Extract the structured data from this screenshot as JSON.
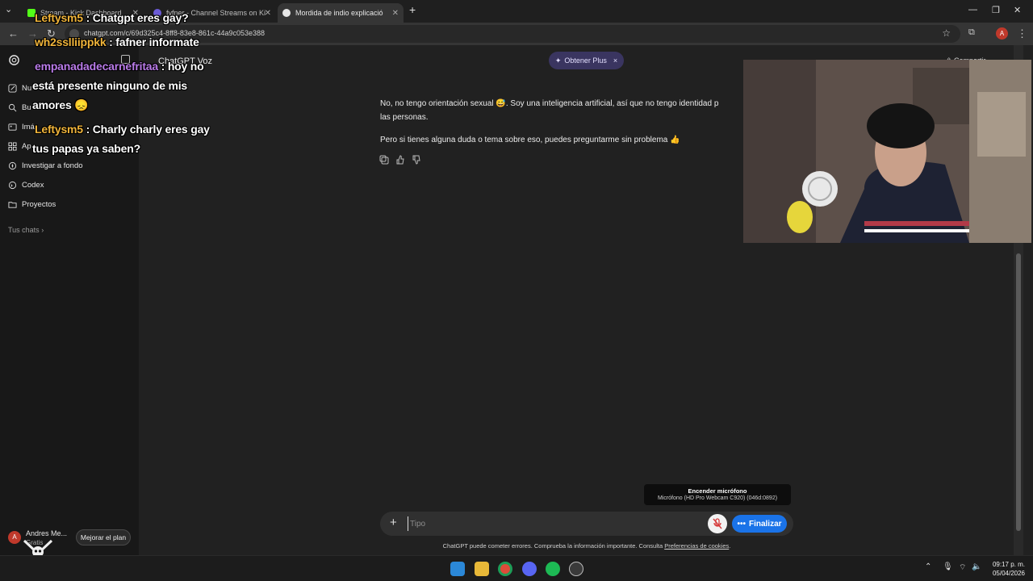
{
  "browser": {
    "tabs": [
      {
        "label": "Stream - Kick Dashboard",
        "favicon_color": "#53fc18"
      },
      {
        "label": "fvfner - Channel Streams on Ki",
        "favicon_color": "#6b5bd6"
      },
      {
        "label": "Mordida de indio explicació",
        "favicon_color": "#e6e6e6"
      }
    ],
    "url": "chatgpt.com/c/69d325c4-8ff8-83e8-861c-44a9c053e388",
    "profile_initial": "A"
  },
  "sidebar": {
    "items": [
      {
        "label": "Nu",
        "icon": "edit-icon"
      },
      {
        "label": "Bu",
        "icon": "search-icon"
      },
      {
        "label": "Imá",
        "icon": "image-icon"
      },
      {
        "label": "Ap",
        "icon": "apps-icon"
      },
      {
        "label": "Investigar a fondo",
        "icon": "research-icon"
      },
      {
        "label": "Codex",
        "icon": "codex-icon"
      },
      {
        "label": "Proyectos",
        "icon": "folder-icon"
      }
    ],
    "tus_chats": "Tus chats",
    "user_name": "Andres Me...",
    "user_plan": "Gratis",
    "upgrade": "Mejorar el plan"
  },
  "header": {
    "model": "ChatGPT Voz",
    "plus_pill": "Obtener Plus",
    "share": "Compartir"
  },
  "messages": {
    "line1": "No, no tengo orientación sexual 😅. Soy una inteligencia artificial, así que no tengo identidad p",
    "line2": "las personas.",
    "line3": "Pero si tienes alguna duda o tema sobre eso, puedes preguntarme sin problema 👍"
  },
  "composer": {
    "placeholder": "Tipo",
    "finish": "Finalizar"
  },
  "tooltip": {
    "title": "Encender micrófono",
    "subtitle": "Micrófono (HD Pro Webcam C920) (046d:0892)"
  },
  "disclaimer": {
    "text": "ChatGPT puede cometer errores. Comprueba la información importante. Consulta ",
    "link": "Preferencias de cookies",
    "suffix": "."
  },
  "chat_overlay": [
    {
      "user": "Leftysm5",
      "msg": " : Chatgpt eres gay?",
      "user_color": "#f0b43a"
    },
    {
      "user": "wh2sslliippkk",
      "msg": " : fafner informate",
      "user_color": "#f0b43a"
    },
    {
      "user": "empanadadecarnefritaa",
      "msg": " : hoy no",
      "user_color": "#b97be8"
    },
    {
      "user": "",
      "msg": "está presente ninguno de mis",
      "user_color": ""
    },
    {
      "user": "",
      "msg": "amores 😞",
      "user_color": ""
    },
    {
      "user": "Leftysm5",
      "msg": " : Charly charly eres gay",
      "user_color": "#f0b43a"
    },
    {
      "user": "",
      "msg": "tus papas ya saben?",
      "user_color": ""
    }
  ],
  "taskbar": {
    "time": "09:17 p. m.",
    "date": "05/04/2026"
  }
}
